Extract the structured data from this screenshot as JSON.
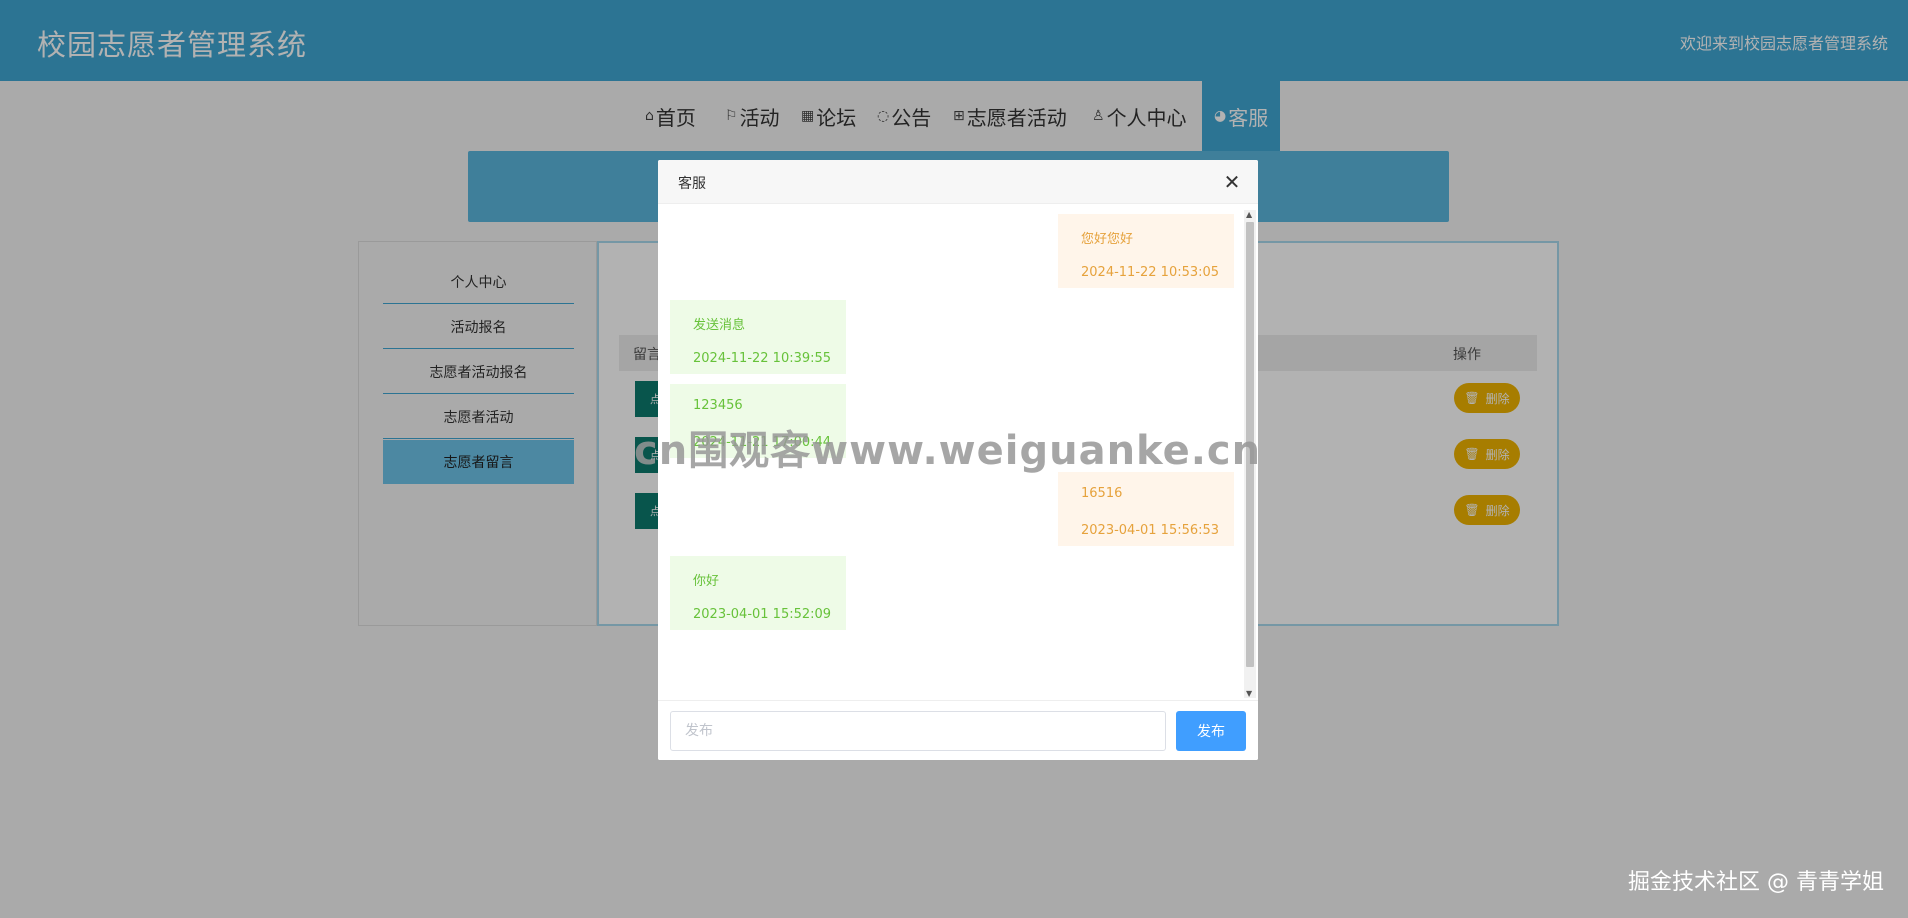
{
  "header": {
    "title": "校园志愿者管理系统",
    "welcome": "欢迎来到校园志愿者管理系统"
  },
  "nav": {
    "items": [
      {
        "label": "首页",
        "icon": "home-icon",
        "glyph": "⌂"
      },
      {
        "label": "活动",
        "icon": "flag-icon",
        "glyph": "⚐"
      },
      {
        "label": "论坛",
        "icon": "calendar-icon",
        "glyph": "▦"
      },
      {
        "label": "公告",
        "icon": "bell-icon",
        "glyph": "◌"
      },
      {
        "label": "志愿者活动",
        "icon": "gift-icon",
        "glyph": "⊞"
      },
      {
        "label": "个人中心",
        "icon": "user-icon",
        "glyph": "♙"
      },
      {
        "label": "客服",
        "icon": "service-icon",
        "glyph": "◕"
      }
    ],
    "active": "客服"
  },
  "sidebar": {
    "items": [
      {
        "label": "个人中心"
      },
      {
        "label": "活动报名"
      },
      {
        "label": "志愿者活动报名"
      },
      {
        "label": "志愿者活动"
      },
      {
        "label": "志愿者留言"
      }
    ],
    "active": "志愿者留言"
  },
  "table": {
    "col_left": "留言",
    "col_action": "操作",
    "row_btn": "点",
    "delete_label": "删除",
    "delete_icon": "trash-icon"
  },
  "dialog": {
    "title": "客服",
    "messages": [
      {
        "side": "right",
        "text": "您好您好",
        "time": "2024-11-22 10:53:05"
      },
      {
        "side": "left",
        "text": "发送消息",
        "time": "2024-11-22 10:39:55"
      },
      {
        "side": "left",
        "text": "123456",
        "time": "2024-11-21 17:00:44"
      },
      {
        "side": "right",
        "text": "16516",
        "time": "2023-04-01 15:56:53"
      },
      {
        "side": "left",
        "text": "你好",
        "time": "2023-04-01 15:52:09"
      }
    ],
    "input_placeholder": "发布",
    "input_value": "",
    "send_label": "发布"
  },
  "watermark": {
    "center": "cn围观客www.weiguanke.cn",
    "corner": "掘金技术社区 @ 青青学姐"
  },
  "colors": {
    "primary": "#3fa6d3",
    "send_button": "#409eff",
    "delete_button": "#f0b400",
    "bubble_right_text": "#e6a23c",
    "bubble_left_text": "#67c23a"
  }
}
